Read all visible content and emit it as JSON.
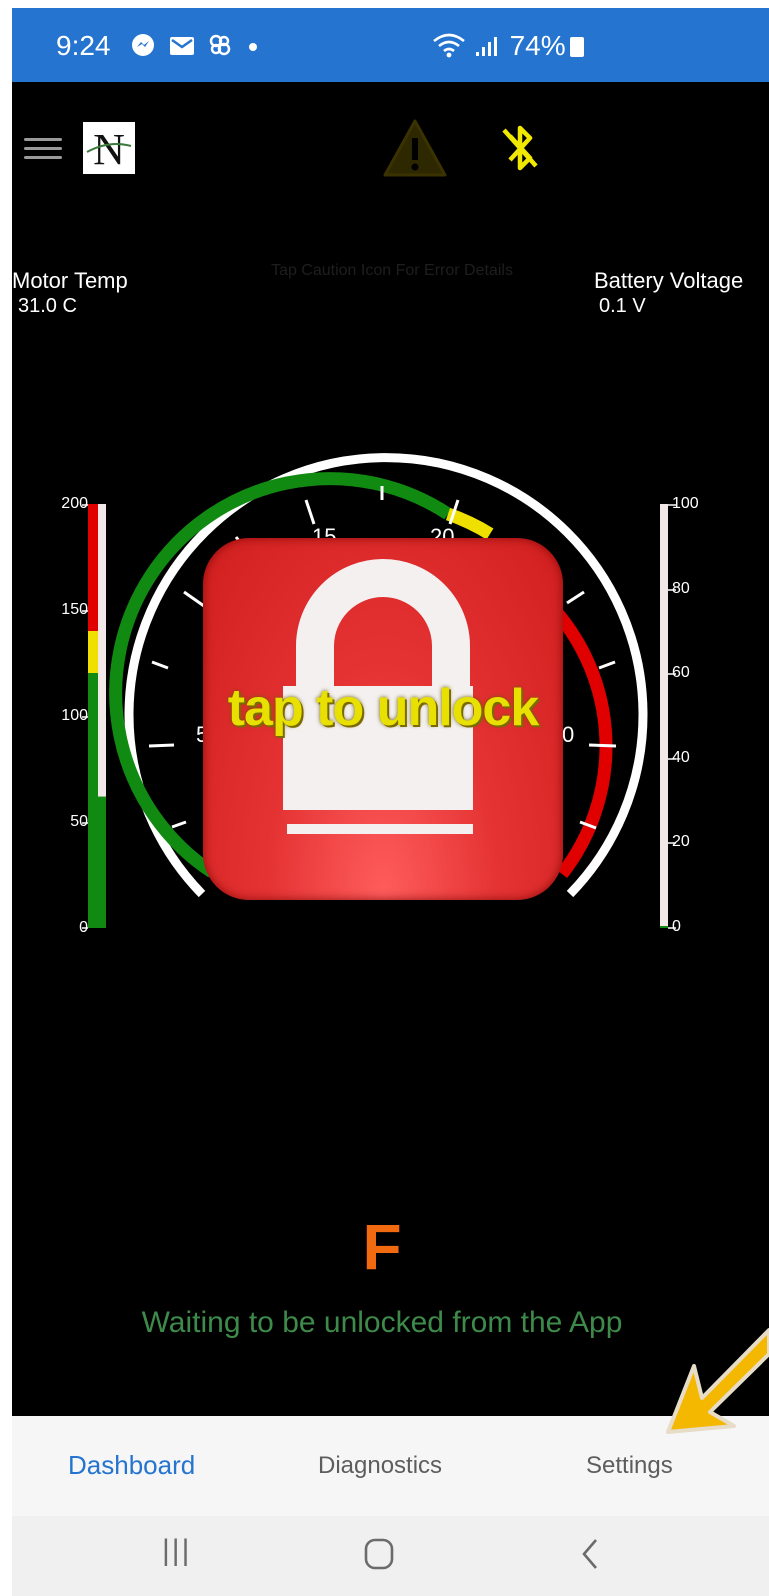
{
  "status_bar": {
    "time": "9:24",
    "notification_icons": [
      "messenger-icon",
      "mail-icon",
      "fan-icon",
      "dot-icon"
    ],
    "signal_text": "ᯤ .ıll",
    "battery": "74%"
  },
  "header": {
    "logo_letter": "N",
    "warning_color": "#3a3000",
    "bluetooth_color": "#f0e800"
  },
  "caution_hint": "Tap Caution Icon For Error Details",
  "motor_temp": {
    "label": "Motor Temp",
    "value": "31.0 C"
  },
  "battery_voltage": {
    "label": "Battery Voltage",
    "value": "0.1 V"
  },
  "left_gauge": {
    "ticks": [
      "200",
      "150",
      "100",
      "50",
      "0"
    ],
    "level_fraction": 0.31
  },
  "right_gauge": {
    "ticks": [
      "100",
      "80",
      "60",
      "40",
      "20",
      "0"
    ],
    "level_fraction": 0.001
  },
  "speedometer": {
    "visible_labels": [
      "5",
      "15",
      "20",
      "0"
    ]
  },
  "lock_overlay": {
    "text": "tap to unlock",
    "color": "#e53333"
  },
  "gear": "F",
  "status_message": "Waiting to be unlocked from the App",
  "bottom_nav": {
    "items": [
      {
        "label": "Dashboard",
        "active": true
      },
      {
        "label": "Diagnostics",
        "active": false
      },
      {
        "label": "Settings",
        "active": false
      }
    ]
  },
  "system_nav": {
    "recent": "|||",
    "home": "○",
    "back": "<"
  },
  "colors": {
    "accent": "#2474d0",
    "app_bg": "#000000",
    "arrow": "#f5b800"
  }
}
